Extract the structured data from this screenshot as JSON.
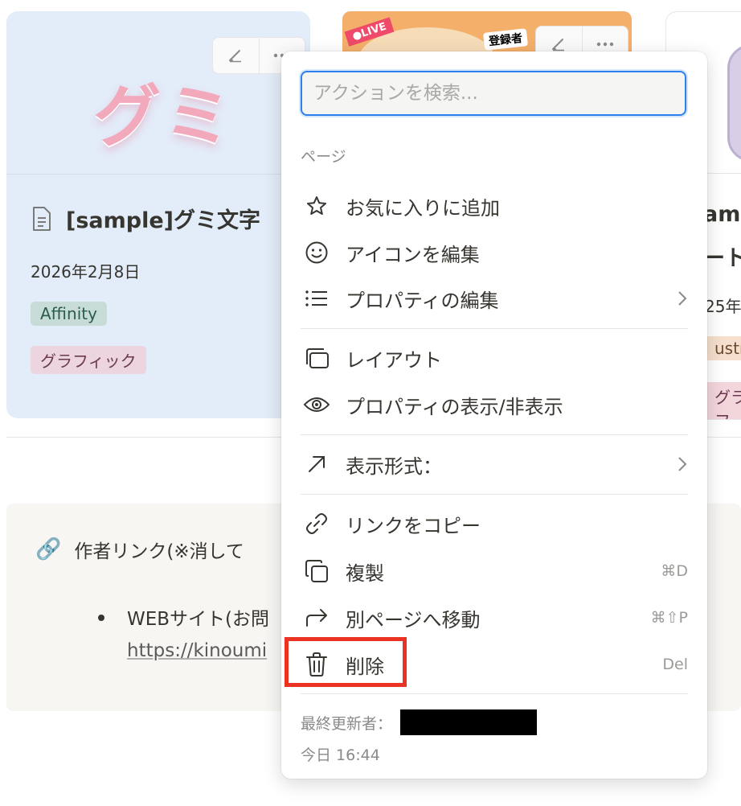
{
  "cards": [
    {
      "cover_text": "グミ",
      "title": "[sample]グミ文字",
      "date": "2026年2月8日",
      "tags": [
        "Affinity",
        "グラフィック"
      ]
    },
    {
      "live_badge": "●LIVE",
      "subscriber_badge": "登録者"
    },
    {
      "title_line1": "am",
      "title_line2": "ート",
      "date": "25年",
      "tags": [
        "ustr",
        "グラフ"
      ]
    }
  ],
  "callout": {
    "icon": "🔗",
    "title": "作者リンク(※消して",
    "item": "WEBサイト(お問",
    "link": "https://kinoumi"
  },
  "menu": {
    "search_placeholder": "アクションを検索...",
    "section_label": "ページ",
    "items": [
      {
        "icon": "star-icon",
        "label": "お気に入りに追加"
      },
      {
        "icon": "smiley-icon",
        "label": "アイコンを編集"
      },
      {
        "icon": "list-icon",
        "label": "プロパティの編集",
        "submenu": true
      },
      {
        "icon": "layout-icon",
        "label": "レイアウト"
      },
      {
        "icon": "eye-icon",
        "label": "プロパティの表示/非表示"
      },
      {
        "icon": "arrow-up-right-icon",
        "label": "表示形式：",
        "submenu": true
      },
      {
        "icon": "link-icon",
        "label": "リンクをコピー"
      },
      {
        "icon": "duplicate-icon",
        "label": "複製",
        "shortcut": "⌘D"
      },
      {
        "icon": "move-arrow-icon",
        "label": "別ページへ移動",
        "shortcut": "⌘⇧P"
      },
      {
        "icon": "trash-icon",
        "label": "削除",
        "shortcut": "Del"
      }
    ],
    "footer_label": "最終更新者：",
    "footer_time": "今日 16:44"
  },
  "colors": {
    "accent": "#2f80ed",
    "highlight": "#ea3323",
    "card_bg": "#e3ecf9"
  }
}
